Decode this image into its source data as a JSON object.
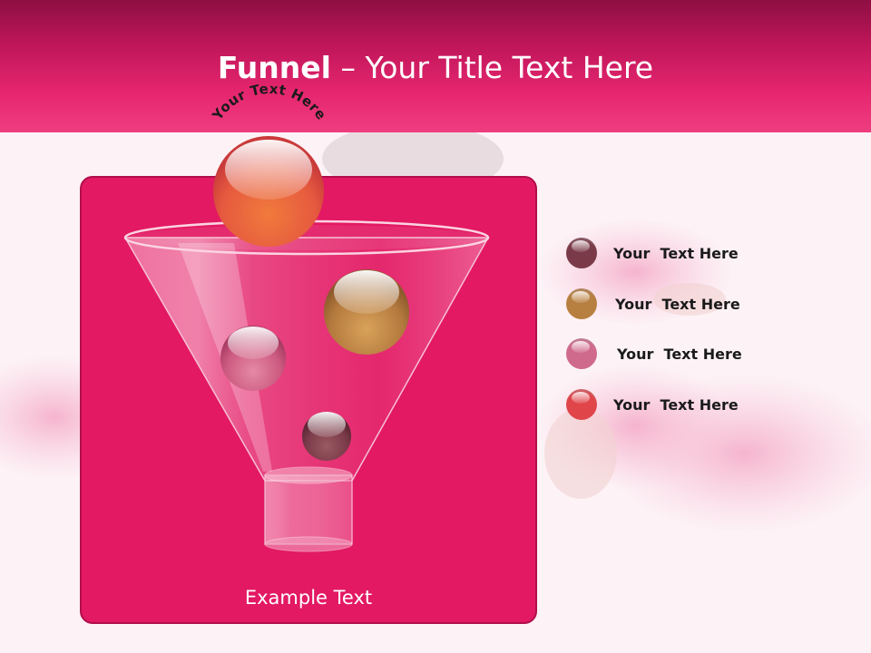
{
  "slide": {
    "title_bold": "Funnel",
    "title_rest": " – Your Title Text Here",
    "arc_text": "Your Text Here",
    "panel_caption": "Example Text"
  },
  "legend": [
    {
      "label": "Your  Text Here",
      "color": "#7a3a48"
    },
    {
      "label": "Your  Text Here",
      "color": "#b88040"
    },
    {
      "label": "Your  Text Here",
      "color": "#d06a8c"
    },
    {
      "label": "Your  Text Here",
      "color": "#e0454a"
    }
  ],
  "colors": {
    "header": "#c0165a",
    "panel": "#e31963",
    "background": "#fdf3f7"
  }
}
